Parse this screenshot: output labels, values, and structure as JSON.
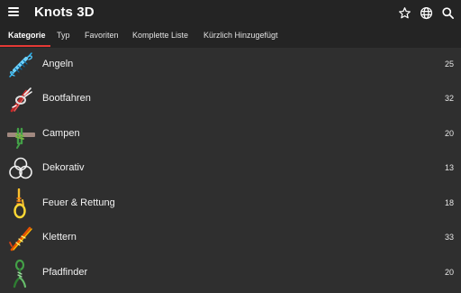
{
  "appbar": {
    "title": "Knots 3D",
    "menu_icon": "menu-icon",
    "actions": [
      "star-icon",
      "globe-icon",
      "search-icon"
    ]
  },
  "tabs": [
    {
      "label": "Kategorie",
      "active": true
    },
    {
      "label": "Typ",
      "active": false
    },
    {
      "label": "Favoriten",
      "active": false
    },
    {
      "label": "Komplette Liste",
      "active": false
    },
    {
      "label": "Kürzlich Hinzugefügt",
      "active": false
    }
  ],
  "colors": {
    "background": "#2f2f2f",
    "appbar": "#242424",
    "tab_indicator": "#e53935"
  },
  "categories": [
    {
      "label": "Angeln",
      "count": "25",
      "icon": "fishing-knot-icon"
    },
    {
      "label": "Bootfahren",
      "count": "32",
      "icon": "boating-knot-icon"
    },
    {
      "label": "Campen",
      "count": "20",
      "icon": "camping-knot-icon"
    },
    {
      "label": "Dekorativ",
      "count": "13",
      "icon": "decorative-knot-icon"
    },
    {
      "label": "Feuer & Rettung",
      "count": "18",
      "icon": "rescue-knot-icon"
    },
    {
      "label": "Klettern",
      "count": "33",
      "icon": "climbing-knot-icon"
    },
    {
      "label": "Pfadfinder",
      "count": "20",
      "icon": "scout-knot-icon"
    }
  ]
}
